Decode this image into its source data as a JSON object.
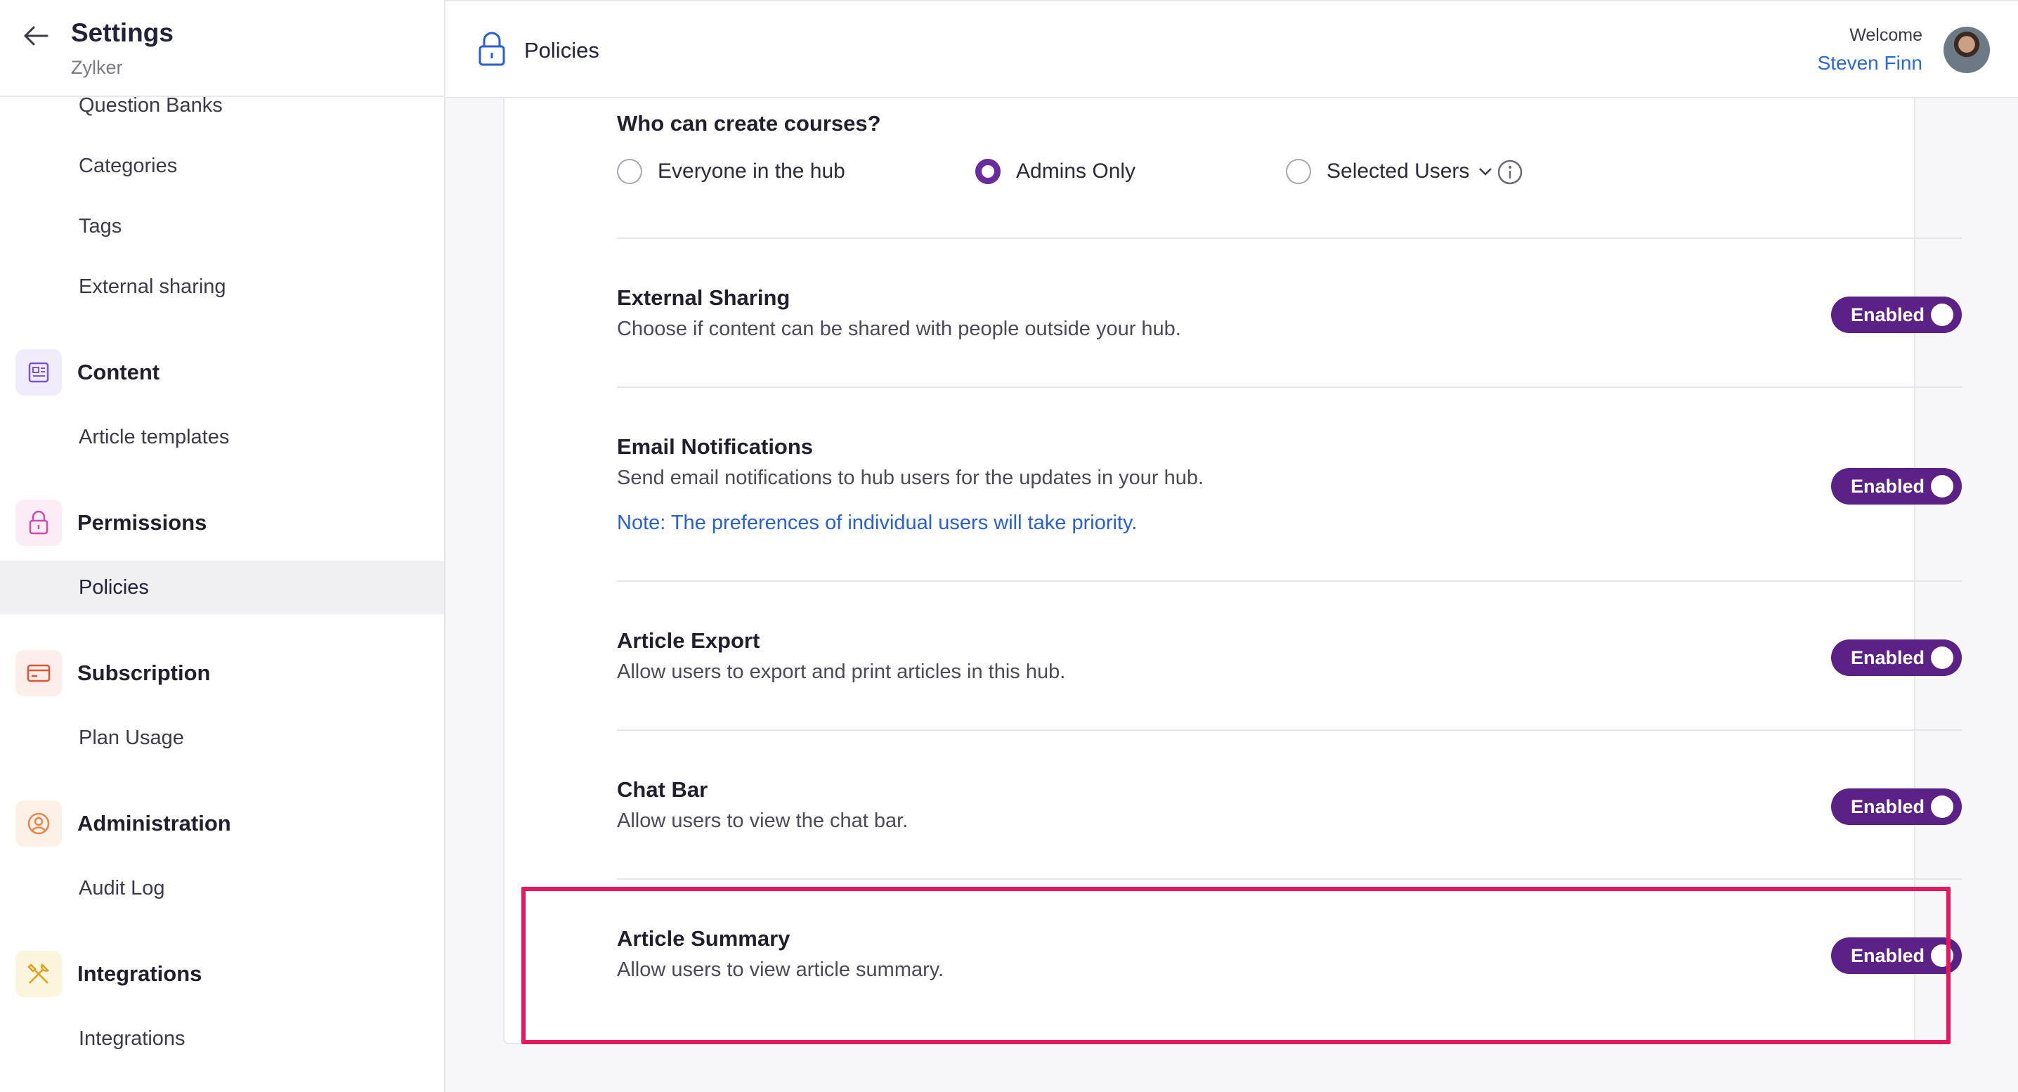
{
  "sidebar": {
    "title": "Settings",
    "org": "Zylker",
    "sub_items_top": [
      "Question Banks",
      "Categories",
      "Tags",
      "External sharing"
    ],
    "sections": [
      {
        "label": "Content",
        "icon": "article-icon",
        "color": "#7a55d6",
        "items": [
          "Article templates"
        ]
      },
      {
        "label": "Permissions",
        "icon": "lock-icon",
        "color": "#d04aa8",
        "items": [
          "Policies"
        ]
      },
      {
        "label": "Subscription",
        "icon": "card-icon",
        "color": "#e0533a",
        "items": [
          "Plan Usage"
        ]
      },
      {
        "label": "Administration",
        "icon": "user-circle-icon",
        "color": "#e8864a",
        "items": [
          "Audit Log"
        ]
      },
      {
        "label": "Integrations",
        "icon": "tools-icon",
        "color": "#d8a21a",
        "items": [
          "Integrations"
        ]
      }
    ],
    "active_item": "Policies"
  },
  "topbar": {
    "title": "Policies",
    "welcome": "Welcome",
    "username": "Steven Finn"
  },
  "courses": {
    "question": "Who can create courses?",
    "options": [
      "Everyone in the hub",
      "Admins Only",
      "Selected Users"
    ],
    "selected": "Admins Only"
  },
  "policies": [
    {
      "title": "External Sharing",
      "desc": "Choose if content can be shared with people outside your hub.",
      "status": "Enabled"
    },
    {
      "title": "Email Notifications",
      "desc": "Send email notifications to hub users for the updates in your hub.",
      "note": "Note: The preferences of individual users will take priority.",
      "status": "Enabled"
    },
    {
      "title": "Article Export",
      "desc": "Allow users to export and print articles in this hub.",
      "status": "Enabled"
    },
    {
      "title": "Chat Bar",
      "desc": "Allow users to view the chat bar.",
      "status": "Enabled"
    },
    {
      "title": "Article Summary",
      "desc": "Allow users to view article summary.",
      "status": "Enabled"
    }
  ],
  "colors": {
    "accent": "#5b2186",
    "highlight": "#e8175d",
    "link": "#2a5fd0"
  }
}
